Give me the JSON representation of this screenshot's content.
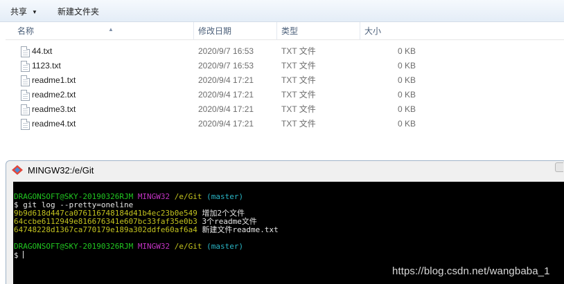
{
  "toolbar": {
    "share_label": "共享",
    "new_folder_label": "新建文件夹"
  },
  "columns": {
    "name": "名称",
    "date": "修改日期",
    "type": "类型",
    "size": "大小"
  },
  "files": [
    {
      "name": "44.txt",
      "date": "2020/9/7 16:53",
      "type": "TXT 文件",
      "size": "0 KB"
    },
    {
      "name": "1123.txt",
      "date": "2020/9/7 16:53",
      "type": "TXT 文件",
      "size": "0 KB"
    },
    {
      "name": "readme1.txt",
      "date": "2020/9/4 17:21",
      "type": "TXT 文件",
      "size": "0 KB"
    },
    {
      "name": "readme2.txt",
      "date": "2020/9/4 17:21",
      "type": "TXT 文件",
      "size": "0 KB"
    },
    {
      "name": "readme3.txt",
      "date": "2020/9/4 17:21",
      "type": "TXT 文件",
      "size": "0 KB"
    },
    {
      "name": "readme4.txt",
      "date": "2020/9/4 17:21",
      "type": "TXT 文件",
      "size": "0 KB"
    }
  ],
  "terminal": {
    "title": "MINGW32:/e/Git",
    "prompt1": {
      "user": "DRAGONSOFT@SKY-20190326RJM",
      "env": "MINGW32",
      "path": "/e/Git",
      "branch": "(master)"
    },
    "command": "$ git log --pretty=oneline",
    "commits": [
      {
        "hash": "9b9d618d447ca076116748184d41b4ec23b0e549",
        "message": "增加2个文件"
      },
      {
        "hash": "64ccbe6112949e816676341e607bc33faf35e0b3",
        "message": "3个readme文件"
      },
      {
        "hash": "64748228d1367ca770179e189a302ddfe60af6a4",
        "message": "新建文件readme.txt"
      }
    ],
    "prompt2": {
      "user": "DRAGONSOFT@SKY-20190326RJM",
      "env": "MINGW32",
      "path": "/e/Git",
      "branch": "(master)"
    },
    "input_line": "$ "
  },
  "watermark": "https://blog.csdn.net/wangbaba_1",
  "colors": {
    "term_user": "#21c721",
    "term_env": "#c333c3",
    "term_path": "#c3c31f",
    "term_branch": "#2ab6c6",
    "explorer_header_text": "#4c607a"
  },
  "icons": {
    "share_dropdown": "chevron-down-icon",
    "sort": "sort-up-icon",
    "file": "text-file-icon",
    "terminal": "git-logo-icon"
  }
}
